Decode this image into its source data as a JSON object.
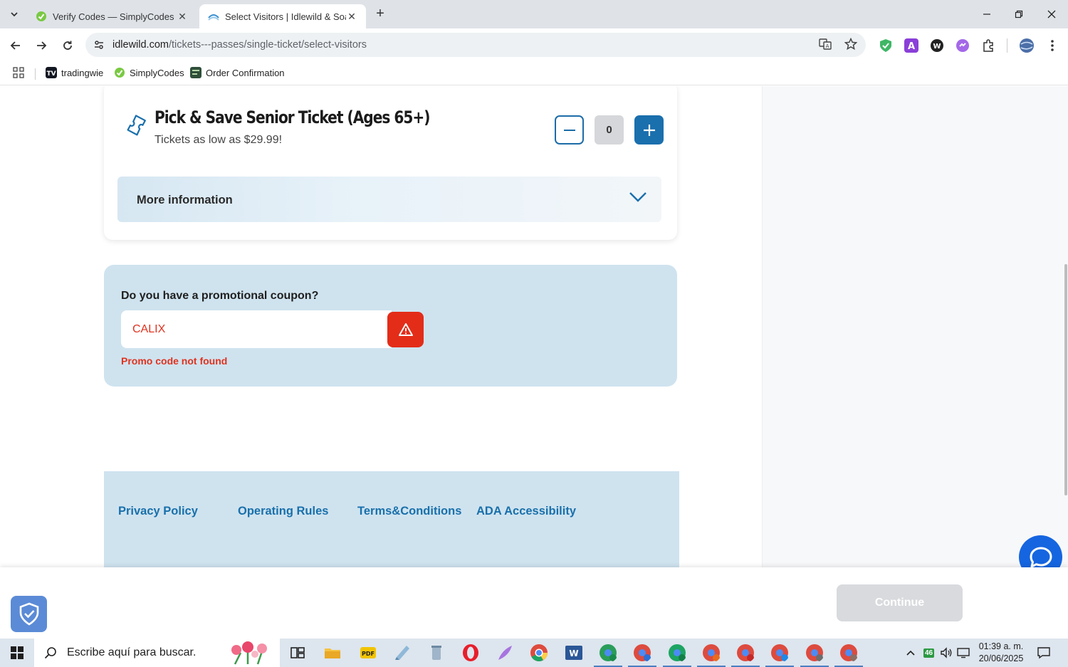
{
  "browser": {
    "tabs": [
      {
        "title": "Verify Codes — SimplyCodes",
        "active": false
      },
      {
        "title": "Select Visitors | Idlewild & Soak",
        "active": true
      }
    ],
    "url_host": "idlewild.com",
    "url_path": "/tickets---passes/single-ticket/select-visitors",
    "bookmarks": [
      {
        "label": "tradingwie"
      },
      {
        "label": "SimplyCodes"
      },
      {
        "label": "Order Confirmation"
      }
    ]
  },
  "ticket": {
    "title": "Pick & Save Senior Ticket (Ages 65+)",
    "subtitle": "Tickets as low as $29.99!",
    "quantity": "0",
    "more_info_label": "More information"
  },
  "promo": {
    "question": "Do you have a promotional coupon?",
    "value": "CALIX",
    "error": "Promo code not found"
  },
  "footer": {
    "links": [
      "Privacy Policy",
      "Operating Rules",
      "Terms&Conditions",
      "ADA Accessibility"
    ]
  },
  "actions": {
    "continue_label": "Continue"
  },
  "taskbar": {
    "search_placeholder": "Escribe aquí para buscar.",
    "clock_time": "01:39 a. m.",
    "clock_date": "20/06/2025",
    "network_badge": "46"
  },
  "colors": {
    "brand_blue": "#1a6fad",
    "error_red": "#e32d19",
    "panel_blue": "#cfe3ef",
    "chat_blue": "#1565e0"
  }
}
